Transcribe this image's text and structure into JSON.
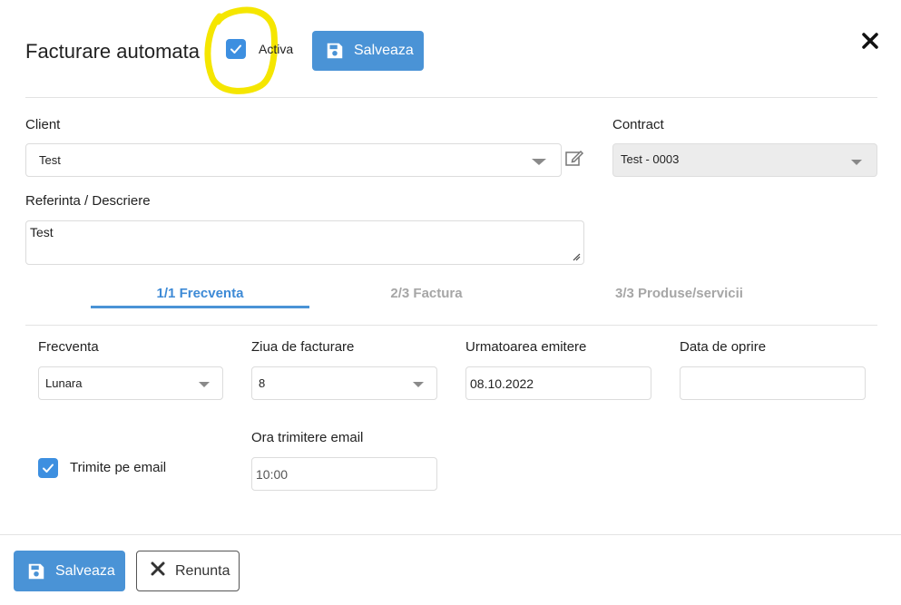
{
  "header": {
    "title": "Facturare automata",
    "active_label": "Activa",
    "save_label": "Salveaza"
  },
  "client": {
    "label": "Client",
    "value": "Test"
  },
  "contract": {
    "label": "Contract",
    "value": "Test - 0003"
  },
  "reference": {
    "label": "Referinta / Descriere",
    "value": "Test"
  },
  "tabs": [
    {
      "label": "1/1 Frecventa",
      "active": true
    },
    {
      "label": "2/3 Factura",
      "active": false
    },
    {
      "label": "3/3 Produse/servicii",
      "active": false
    }
  ],
  "frequency": {
    "frecventa": {
      "label": "Frecventa",
      "value": "Lunara"
    },
    "ziua": {
      "label": "Ziua de facturare",
      "value": "8"
    },
    "urmatoarea": {
      "label": "Urmatoarea emitere",
      "value": "08.10.2022"
    },
    "oprire": {
      "label": "Data de oprire",
      "value": ""
    },
    "email_checkbox_label": "Trimite pe email",
    "ora": {
      "label": "Ora trimitere email",
      "value": "10:00"
    }
  },
  "footer": {
    "save_label": "Salveaza",
    "cancel_label": "Renunta"
  },
  "colors": {
    "accent": "#4a93d6",
    "tab_active": "#3d8ad6",
    "highlight": "#f5e600"
  },
  "icons": [
    "check-icon",
    "save-icon",
    "close-icon",
    "edit-icon",
    "chevron-down-icon"
  ]
}
